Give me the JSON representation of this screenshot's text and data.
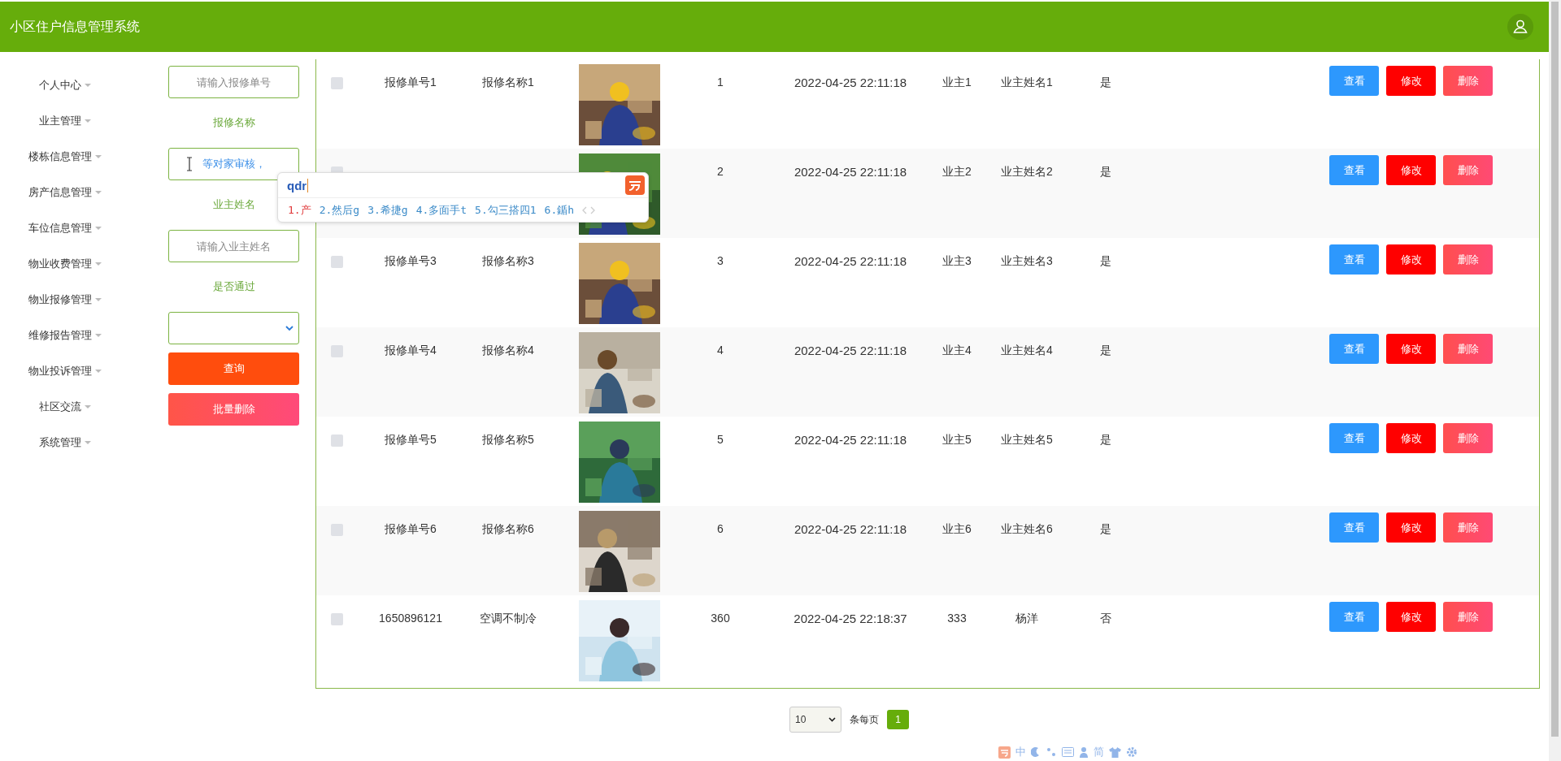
{
  "header": {
    "title": "小区住户信息管理系统"
  },
  "nav": [
    {
      "label": "个人中心"
    },
    {
      "label": "业主管理"
    },
    {
      "label": "楼栋信息管理"
    },
    {
      "label": "房产信息管理"
    },
    {
      "label": "车位信息管理"
    },
    {
      "label": "物业收费管理"
    },
    {
      "label": "物业报修管理"
    },
    {
      "label": "维修报告管理"
    },
    {
      "label": "物业投诉管理"
    },
    {
      "label": "社区交流"
    },
    {
      "label": "系统管理"
    }
  ],
  "filters": [
    {
      "kind": "input",
      "placeholder": "请输入报修单号"
    },
    {
      "kind": "label",
      "text": "报修名称"
    },
    {
      "kind": "input",
      "value": "等对家审核，"
    },
    {
      "kind": "label",
      "text": "业主姓名"
    },
    {
      "kind": "input",
      "placeholder": "请输入业主姓名"
    },
    {
      "kind": "label",
      "text": "是否通过"
    },
    {
      "kind": "select"
    },
    {
      "kind": "submit",
      "label": "查询"
    },
    {
      "kind": "bulk",
      "label": "批量删除"
    }
  ],
  "rows": [
    {
      "checked": false,
      "number": "报修单号1",
      "name": "报修名称1",
      "quantity": "1",
      "time": "2022-04-25 22:11:18",
      "owner": "业主1",
      "owner_name": "业主姓名1",
      "approved": "是",
      "actions": [
        "查看",
        "修改",
        "删除"
      ]
    },
    {
      "checked": false,
      "quantity": "2",
      "time": "2022-04-25 22:11:18",
      "owner": "业主2",
      "owner_name": "业主姓名2",
      "approved": "是",
      "actions": [
        "查看",
        "修改",
        "删除"
      ]
    },
    {
      "checked": false,
      "number": "报修单号3",
      "name": "报修名称3",
      "quantity": "3",
      "time": "2022-04-25 22:11:18",
      "owner": "业主3",
      "owner_name": "业主姓名3",
      "approved": "是",
      "actions": [
        "查看",
        "修改",
        "删除"
      ]
    },
    {
      "checked": false,
      "number": "报修单号4",
      "name": "报修名称4",
      "quantity": "4",
      "time": "2022-04-25 22:11:18",
      "owner": "业主4",
      "owner_name": "业主姓名4",
      "approved": "是",
      "actions": [
        "查看",
        "修改",
        "删除"
      ]
    },
    {
      "checked": false,
      "number": "报修单号5",
      "name": "报修名称5",
      "quantity": "5",
      "time": "2022-04-25 22:11:18",
      "owner": "业主5",
      "owner_name": "业主姓名5",
      "approved": "是",
      "actions": [
        "查看",
        "修改",
        "删除"
      ]
    },
    {
      "checked": false,
      "number": "报修单号6",
      "name": "报修名称6",
      "quantity": "6",
      "time": "2022-04-25 22:11:18",
      "owner": "业主6",
      "owner_name": "业主姓名6",
      "approved": "是",
      "actions": [
        "查看",
        "修改",
        "删除"
      ]
    },
    {
      "checked": false,
      "number": "1650896121",
      "name": "空调不制冷",
      "quantity": "360",
      "time": "2022-04-25 22:18:37",
      "owner": "333",
      "owner_name": "杨洋",
      "approved": "否",
      "actions": [
        "查看",
        "修改",
        "删除"
      ]
    }
  ],
  "pagination": {
    "page_size": "10",
    "per_page_label": "条每页",
    "pages": [
      {
        "label": "1",
        "selected": true
      }
    ]
  },
  "ime": {
    "composition": "qdr",
    "candidates": [
      {
        "text": "1.产",
        "selected": true
      },
      {
        "text": "2.然后g",
        "selected": false
      },
      {
        "text": "3.希捷g",
        "selected": false
      },
      {
        "text": "4.多面手t",
        "selected": false
      },
      {
        "text": "5.勾三搭四1",
        "selected": false
      },
      {
        "text": "6.鍎h",
        "selected": false
      }
    ]
  },
  "ime_bar": {
    "mode": "中",
    "charset": "简"
  }
}
